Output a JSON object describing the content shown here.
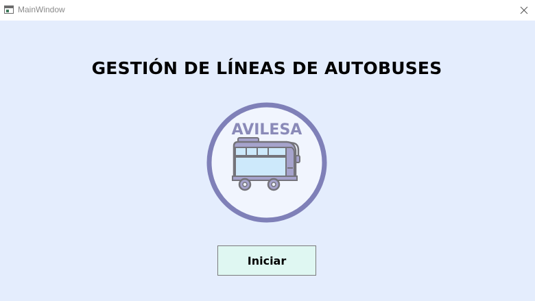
{
  "window": {
    "title": "MainWindow",
    "close_icon": "close-icon",
    "app_icon": "window-app-icon"
  },
  "main": {
    "heading": "GESTIÓN DE LÍNEAS DE AUTOBUSES",
    "logo": {
      "brand": "AVILESA",
      "icon": "bus-icon",
      "colors": {
        "ring": "#7f80b8",
        "inner": "#f1f5fe",
        "brand_text": "#8a8ab8",
        "bus_body": "#a6a3cc",
        "bus_windows": "#cde9fb"
      }
    },
    "start_button_label": "Iniciar"
  },
  "colors": {
    "background": "#e4edfd",
    "button_fill": "#dff7f2",
    "button_border": "#7a7a7a"
  }
}
